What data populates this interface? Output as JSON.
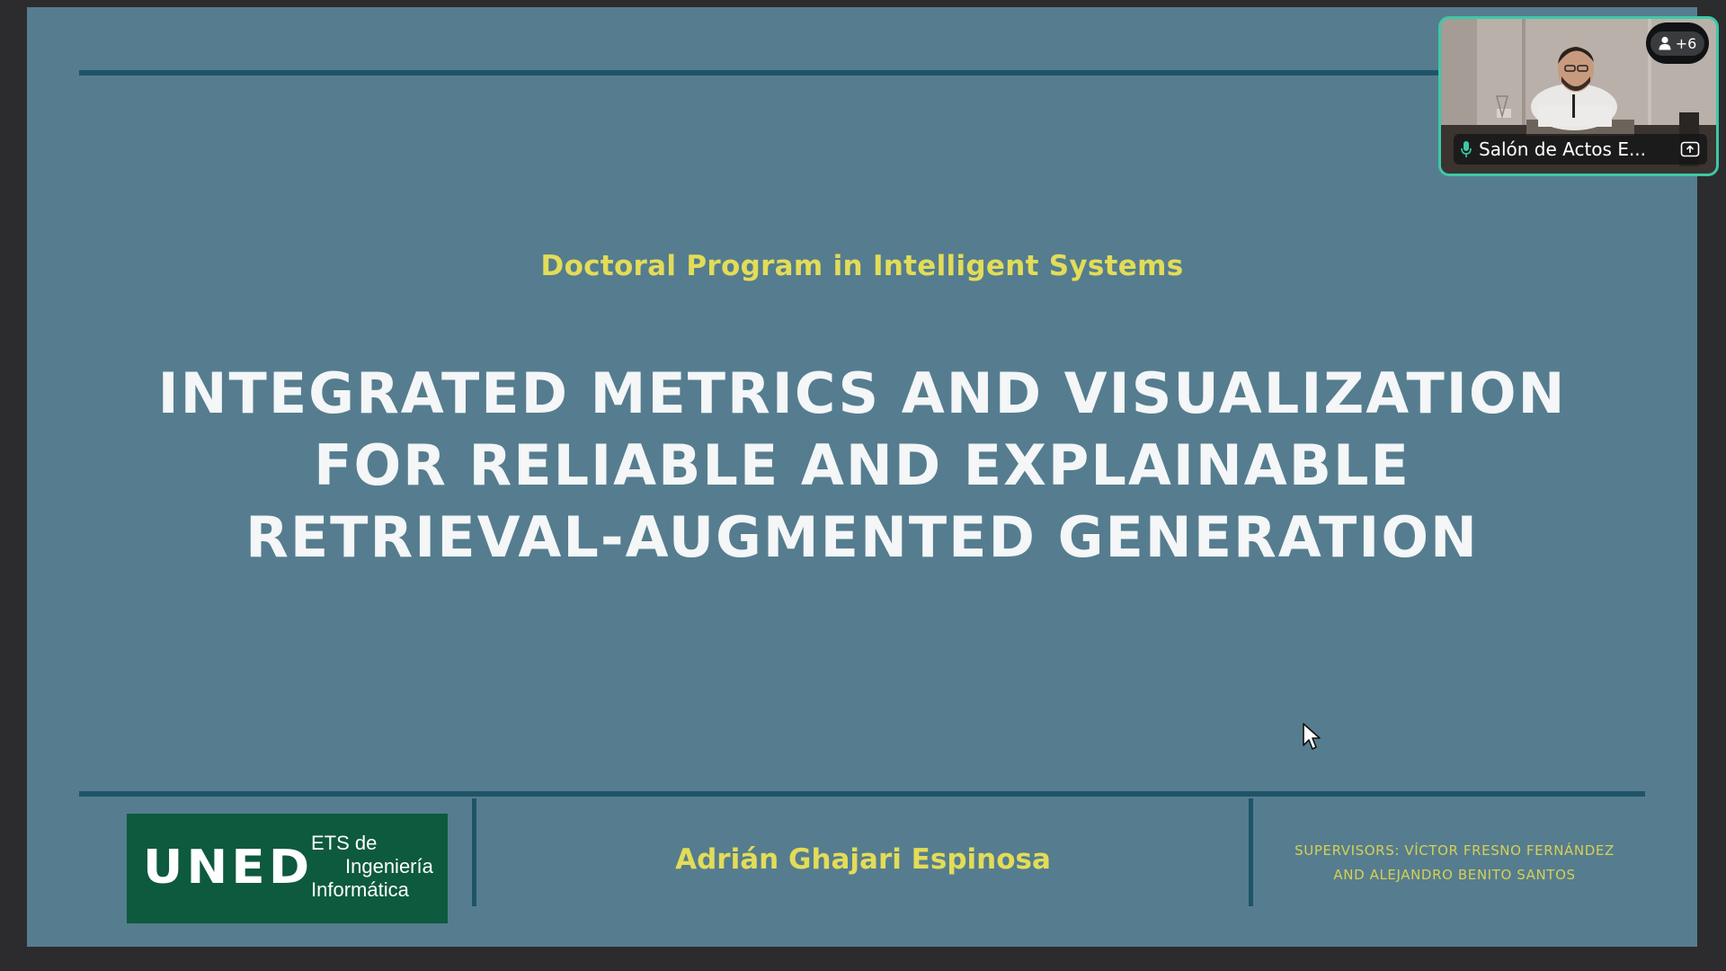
{
  "slide": {
    "program": "Doctoral Program in Intelligent Systems",
    "title_lines": [
      "INTEGRATED METRICS AND VISUALIZATION",
      "FOR RELIABLE AND EXPLAINABLE",
      "RETRIEVAL-AUGMENTED GENERATION"
    ],
    "author": "Adrián Ghajari Espinosa",
    "supervisors_lines": [
      "SUPERVISORS: VÍCTOR FRESNO FERNÁNDEZ",
      "AND ALEJANDRO BENITO SANTOS"
    ],
    "logo": {
      "mark": "UNED",
      "text_lines": [
        "ETS de",
        "Ingeniería",
        "Informática"
      ]
    }
  },
  "video_tile": {
    "participant_name": "Salón de Actos E...",
    "extra_participants": "+6",
    "icons": {
      "mic": "microphone-icon",
      "person": "person-icon",
      "share": "screen-share-icon"
    }
  },
  "colors": {
    "slide_bg": "#557d8f",
    "accent_yellow": "#e3dc58",
    "title_white": "#f4f6f7",
    "rule": "#1f5468",
    "logo_green": "#0d5a3e",
    "tile_border": "#3bc9a7"
  }
}
